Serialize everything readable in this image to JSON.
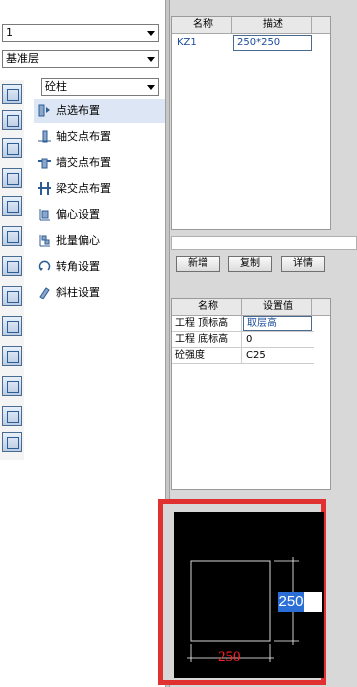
{
  "left_panel": {
    "floor_combo": "1",
    "layer_combo": "基准层",
    "component_combo": "砼柱",
    "commands": [
      {
        "label": "点选布置"
      },
      {
        "label": "轴交点布置"
      },
      {
        "label": "墙交点布置"
      },
      {
        "label": "梁交点布置"
      },
      {
        "label": "偏心设置"
      },
      {
        "label": "批量偏心"
      },
      {
        "label": "转角设置"
      },
      {
        "label": "斜柱设置"
      }
    ]
  },
  "top_table": {
    "col_name": "名称",
    "col_desc": "描述",
    "rows": [
      {
        "name": "KZ1",
        "desc": "250*250"
      }
    ]
  },
  "buttons": {
    "new": "新增",
    "copy": "复制",
    "detail": "详情"
  },
  "prop_table": {
    "col_name": "名称",
    "col_value": "设置值",
    "rows": [
      {
        "name": "工程 顶标高",
        "value": "取层高"
      },
      {
        "name": "工程 底标高",
        "value": "0"
      },
      {
        "name": "砼强度",
        "value": "C25"
      }
    ]
  },
  "preview": {
    "dim_bottom": "250",
    "dim_right": "250",
    "highlight_color": "#e03030"
  },
  "colors": {
    "selected_bg": "#dce6f4",
    "dim_red": "#ff2020",
    "dim_right_bg": "#ffffff"
  }
}
